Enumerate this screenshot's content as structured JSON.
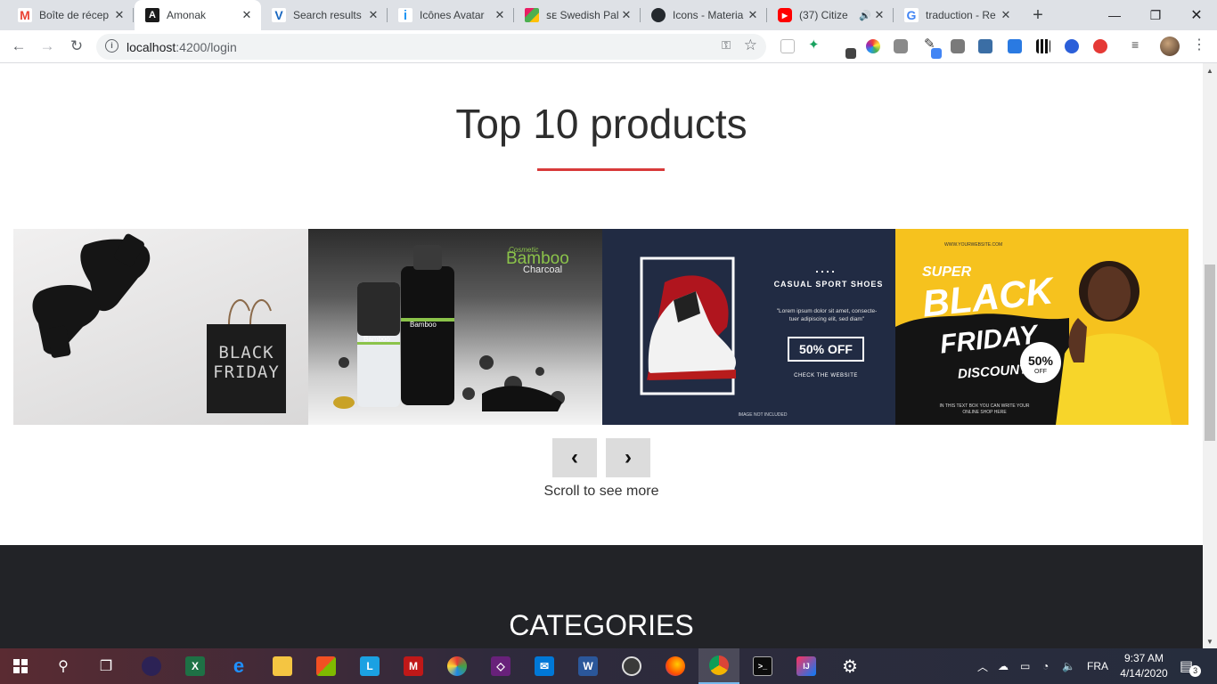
{
  "browser": {
    "tabs": [
      {
        "title": "Boîte de récep",
        "favicon": "gmail-icon",
        "color": "#ea4335",
        "glyph": "M"
      },
      {
        "title": "Amonak",
        "favicon": "angular-icon",
        "color": "#1a1a1a",
        "glyph": "A"
      },
      {
        "title": "Search results",
        "favicon": "vuetify-icon",
        "color": "#1867c0",
        "glyph": "V"
      },
      {
        "title": "Icônes Avatar",
        "favicon": "iconscout-icon",
        "color": "#2196f3",
        "glyph": "i"
      },
      {
        "title": "ꜱᴇ Swedish Pal",
        "favicon": "palette-icon",
        "color": "#e91e63",
        "glyph": "■"
      },
      {
        "title": "Icons - Materia",
        "favicon": "github-icon",
        "color": "#24292e",
        "glyph": "●"
      },
      {
        "title": "(37) Citize",
        "favicon": "youtube-icon",
        "color": "#ff0000",
        "glyph": "▶"
      },
      {
        "title": "traduction - Re",
        "favicon": "google-icon",
        "color": "#4285f4",
        "glyph": "G"
      }
    ],
    "active_tab": 1,
    "url_host": "localhost",
    "url_rest": ":4200/login"
  },
  "page": {
    "heading": "Top 10 products",
    "accent_color": "#d83a3a",
    "slides": [
      {
        "name": "black-friday-shoes-slide",
        "bag_text": "BLACK FRIDAY"
      },
      {
        "name": "bamboo-charcoal-slide",
        "brand": "Cosmetic",
        "title": "Bamboo",
        "subtitle": "Charcoal",
        "tube_label": "Bamboo"
      },
      {
        "name": "casual-sport-shoes-slide",
        "title": "CASUAL SPORT SHOES",
        "body": "\"Lorem ipsum dolor sit amet, consecte-tuer adipiscing elit, sed diam\"",
        "offer": "50% OFF",
        "cta": "CHECK THE WEBSITE",
        "note": "IMAGE NOT INCLUDED"
      },
      {
        "name": "super-black-friday-slide",
        "super": "SUPER",
        "black": "BLACK",
        "friday": "FRIDAY",
        "discount": "DISCOUNT",
        "badge_pct": "50%",
        "badge_off": "OFF",
        "site": "WWW.YOURWEBSITE.COM",
        "footer": "IN THIS TEXT BOX YOU CAN WRITE YOUR ONLINE SHOP HERE"
      }
    ],
    "prev_label": "‹",
    "next_label": "›",
    "scroll_hint": "Scroll to see more",
    "categories_heading": "CATEGORIES"
  },
  "taskbar": {
    "language": "FRA",
    "time": "9:37 AM",
    "date": "4/14/2020",
    "notifications": "3"
  }
}
